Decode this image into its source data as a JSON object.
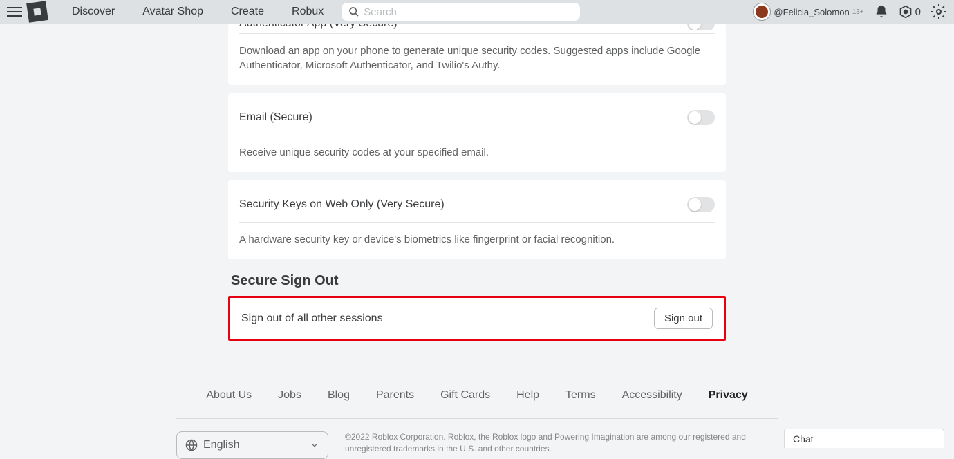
{
  "nav": {
    "links": [
      "Discover",
      "Avatar Shop",
      "Create",
      "Robux"
    ],
    "search_placeholder": "Search",
    "username": "@Felicia_Solomon",
    "age_badge": "13+",
    "robux_amount": "0"
  },
  "cards": {
    "authenticator": {
      "title": "Authenticator App (Very Secure)",
      "desc": "Download an app on your phone to generate unique security codes. Suggested apps include Google Authenticator, Microsoft Authenticator, and Twilio's Authy."
    },
    "email": {
      "title": "Email (Secure)",
      "desc": "Receive unique security codes at your specified email."
    },
    "security_keys": {
      "title": "Security Keys on Web Only (Very Secure)",
      "desc": "A hardware security key or device's biometrics like fingerprint or facial recognition."
    }
  },
  "secure_signout": {
    "heading": "Secure Sign Out",
    "label": "Sign out of all other sessions",
    "button": "Sign out"
  },
  "footer": {
    "links": [
      "About Us",
      "Jobs",
      "Blog",
      "Parents",
      "Gift Cards",
      "Help",
      "Terms",
      "Accessibility",
      "Privacy"
    ],
    "active_link": "Privacy",
    "language": "English",
    "copyright": "©2022 Roblox Corporation. Roblox, the Roblox logo and Powering Imagination are among our registered and unregistered trademarks in the U.S. and other countries."
  },
  "chat": {
    "label": "Chat"
  }
}
